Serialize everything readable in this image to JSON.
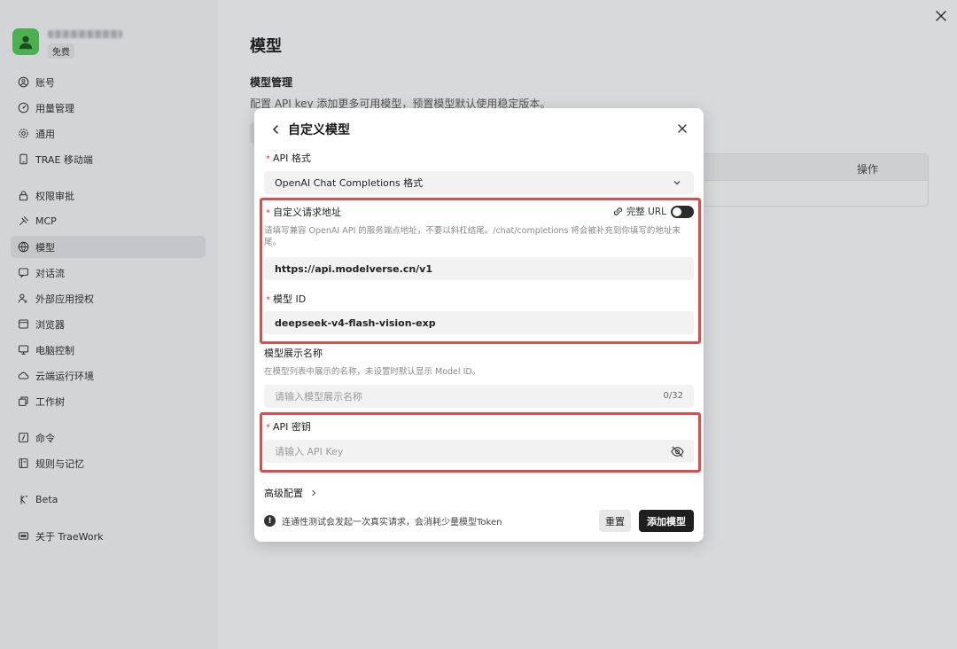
{
  "sidebar": {
    "user": {
      "plan_badge": "免费"
    },
    "items": [
      {
        "label": "账号",
        "icon": "account-icon"
      },
      {
        "label": "用量管理",
        "icon": "usage-icon"
      },
      {
        "label": "通用",
        "icon": "gear-icon"
      },
      {
        "label": "TRAE 移动端",
        "icon": "mobile-icon"
      },
      {
        "label": "权限审批",
        "icon": "lock-icon"
      },
      {
        "label": "MCP",
        "icon": "mcp-icon"
      },
      {
        "label": "模型",
        "icon": "model-icon",
        "active": true
      },
      {
        "label": "对话流",
        "icon": "chat-flow-icon"
      },
      {
        "label": "外部应用授权",
        "icon": "external-app-icon"
      },
      {
        "label": "浏览器",
        "icon": "browser-icon"
      },
      {
        "label": "电脑控制",
        "icon": "monitor-icon"
      },
      {
        "label": "云端运行环境",
        "icon": "cloud-icon"
      },
      {
        "label": "工作树",
        "icon": "worktree-icon"
      },
      {
        "label": "命令",
        "icon": "command-icon"
      },
      {
        "label": "规则与记忆",
        "icon": "rules-icon"
      },
      {
        "label": "Beta",
        "icon": "beta-icon"
      },
      {
        "label": "关于 TraeWork",
        "icon": "about-icon"
      }
    ]
  },
  "main": {
    "title": "模型",
    "section_title": "模型管理",
    "section_desc": "配置 API key 添加更多可用模型，预置模型默认使用稳定版本。",
    "table_header_action": "操作"
  },
  "modal": {
    "title": "自定义模型",
    "api_format": {
      "label": "API 格式",
      "value": "OpenAI Chat Completions 格式"
    },
    "endpoint": {
      "label": "自定义请求地址",
      "help": "请填写兼容 OpenAI API 的服务端点地址，不要以斜杠结尾。/chat/completions 将会被补充到你填写的地址末尾。",
      "value": "https://api.modelverse.cn/v1",
      "full_url_label": "完整 URL",
      "full_url_enabled": false
    },
    "model_id": {
      "label": "模型 ID",
      "value": "deepseek-v4-flash-vision-exp"
    },
    "display_name": {
      "label": "模型展示名称",
      "help": "在模型列表中展示的名称，未设置时默认显示 Model ID。",
      "placeholder": "请输入模型展示名称",
      "counter": "0/32"
    },
    "api_key": {
      "label": "API 密钥",
      "placeholder": "请输入 API Key"
    },
    "advanced_label": "高级配置",
    "footer_note": "连通性测试会发起一次真实请求，会消耗少量模型Token",
    "info_glyph": "!",
    "reset_label": "重置",
    "add_label": "添加模型",
    "required_mark": "*",
    "highlight_color": "#e04b4b"
  }
}
